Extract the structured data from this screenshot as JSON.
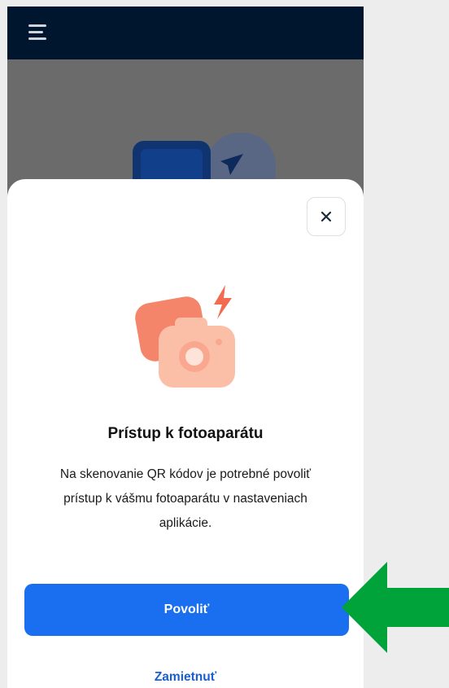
{
  "topbar": {
    "menu_icon": "hamburger-menu-icon"
  },
  "background": {
    "illustration": "phone-with-paper-plane-illustration"
  },
  "dialog": {
    "close_icon": "close-icon",
    "illustration": "camera-illustration",
    "title": "Prístup k fotoaparátu",
    "body": "Na skenovanie QR kódov je potrebné povoliť prístup k vášmu fotoaparátu v nastaveniach aplikácie.",
    "allow_label": "Povoliť",
    "deny_label": "Zamietnuť"
  },
  "annotation": {
    "arrow_icon": "green-arrow-pointer-icon"
  },
  "colors": {
    "topbar": "#00152e",
    "primary_button": "#1a6ff0",
    "link": "#1a5fcf",
    "arrow": "#00a23a",
    "illustration_accent": "#f7806a"
  }
}
